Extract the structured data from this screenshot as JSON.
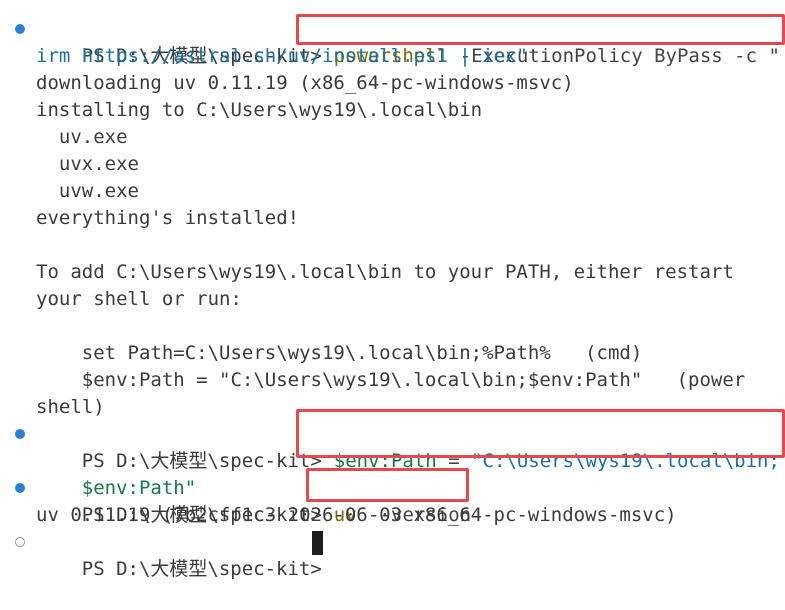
{
  "terminal": {
    "prompt": "PS D:\\大模型\\spec-kit>",
    "block1": {
      "cmd_name": "powershell",
      "cmd_args": " -ExecutionPolicy ByPass -c \"",
      "cmd_cont": "irm https://astral.sh/uv/install.ps1 | iex\"",
      "output": [
        "downloading uv 0.11.19 (x86_64-pc-windows-msvc)",
        "installing to C:\\Users\\wys19\\.local\\bin",
        "  uv.exe",
        "  uvx.exe",
        "  uvw.exe",
        "everything's installed!",
        "",
        "To add C:\\Users\\wys19\\.local\\bin to your PATH, either restart",
        "your shell or run:",
        "",
        "    set Path=C:\\Users\\wys19\\.local\\bin;%Path%   (cmd)",
        "    $env:Path = \"C:\\Users\\wys19\\.local\\bin;$env:Path\"   (power",
        "shell)"
      ]
    },
    "block2": {
      "cmd_var": "$env:Path",
      "cmd_op": " = ",
      "cmd_str": "\"C:\\Users\\wys19\\.local\\bin;",
      "cmd_cont": "$env:Path\""
    },
    "block3": {
      "cmd_name": "uv",
      "cmd_args": " --version",
      "output": "uv 0.11.19 (7b2cff1c3 2026-06-03 x86_64-pc-windows-msvc)"
    },
    "colors": {
      "prompt_dot": "#2b7fd0",
      "highlight": "#e5484d"
    }
  }
}
